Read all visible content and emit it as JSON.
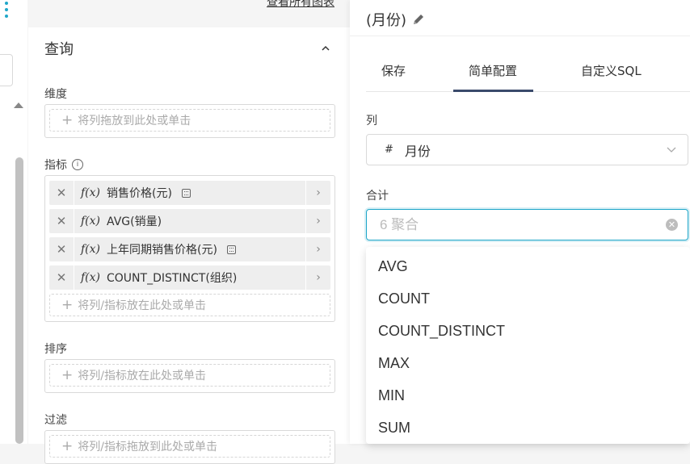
{
  "header": {
    "view_all_charts": "查看所有图表"
  },
  "query_panel": {
    "title": "查询",
    "dimensions_label": "维度",
    "dimensions_placeholder": "将列拖放到此处或单击",
    "metrics_label": "指标",
    "metrics": [
      {
        "fx": "f(x)",
        "label": "销售价格(元)",
        "has_calc_icon": true
      },
      {
        "fx": "f(x)",
        "label": "AVG(销量)",
        "has_calc_icon": false
      },
      {
        "fx": "f(x)",
        "label": "上年同期销售价格(元)",
        "has_calc_icon": true
      },
      {
        "fx": "f(x)",
        "label": "COUNT_DISTINCT(组织)",
        "has_calc_icon": false
      }
    ],
    "metrics_placeholder": "将列/指标放在此处或单击",
    "sort_label": "排序",
    "sort_placeholder": "将列/指标放在此处或单击",
    "filter_label": "过滤",
    "filter_placeholder": "将列/指标拖放到此处或单击"
  },
  "edit_panel": {
    "title": "(月份)",
    "tabs": [
      "保存",
      "简单配置",
      "自定义SQL"
    ],
    "active_tab": "简单配置",
    "column_label": "列",
    "column_type_icon": "#",
    "column_value": "月份",
    "aggregate_label": "合计",
    "aggregate_placeholder": "6 聚合",
    "options": [
      "AVG",
      "COUNT",
      "COUNT_DISTINCT",
      "MAX",
      "MIN",
      "SUM"
    ]
  },
  "colors": {
    "accent": "#20a7c9",
    "tab_underline": "#3a4a6b"
  }
}
